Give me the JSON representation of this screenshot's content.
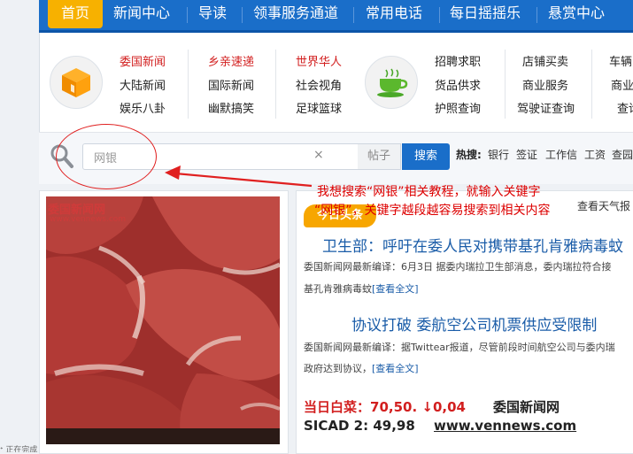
{
  "nav": {
    "items": [
      {
        "label": "首页",
        "active": true
      },
      {
        "label": "新闻中心"
      },
      {
        "label": "导读"
      },
      {
        "label": "领事服务通道"
      },
      {
        "label": "常用电话"
      },
      {
        "label": "每日摇摇乐"
      },
      {
        "label": "悬赏中心"
      }
    ]
  },
  "categories": {
    "col1": [
      "委国新闻",
      "大陆新闻",
      "娱乐八卦"
    ],
    "col2": [
      "乡亲速递",
      "国际新闻",
      "幽默搞笑"
    ],
    "col3": [
      "世界华人",
      "社会视角",
      "足球篮球"
    ],
    "col4": [
      "招聘求职",
      "货品供求",
      "护照查询"
    ],
    "col5": [
      "店铺买卖",
      "商业服务",
      "驾驶证查询"
    ],
    "col6": [
      "车辆",
      "商业",
      "查询"
    ],
    "icons": [
      "box-icon",
      "coffee-cup-icon"
    ]
  },
  "search": {
    "value": "网银",
    "clear": "×",
    "type": "帖子",
    "button": "搜索",
    "hot_label": "热搜:",
    "hot": [
      "银行",
      "签证",
      "工作信",
      "工资",
      "查园"
    ]
  },
  "annotation": {
    "line1": "我想搜索“网银”相关教程，就输入关键字",
    "line2": "“网银”，关键字越段越容易搜索到相关内容"
  },
  "left": {
    "watermark": "委国新闻网",
    "watermark_sub": "www.vennews.com"
  },
  "news": {
    "badge": "今日头条",
    "weather": "查看天气报",
    "items": [
      {
        "title": "卫生部：呼吁在委人民对携带基孔肯雅病毒蚊",
        "summary1": "委国新闻网最新编译：6月3日 据委内瑞拉卫生部消息，委内瑞拉符合接",
        "summary2": "基孔肯雅病毒蚊",
        "more": "[查看全文]"
      },
      {
        "title": "协议打破 委航空公司机票供应受限制",
        "summary1": "委国新闻网最新编译：据Twittear报道，尽管前段时间航空公司与委内瑞",
        "summary2": "政府达到协议，",
        "more": "[查看全文]"
      }
    ]
  },
  "exchange": {
    "label1": "当日白菜：",
    "value1": "70,50.",
    "change1": "↓0,04",
    "site": "委国新闻网",
    "label2": "SICAD 2:",
    "value2": "49,98",
    "url": "www.vennews.com"
  },
  "status": "ᐩ 正在完成"
}
